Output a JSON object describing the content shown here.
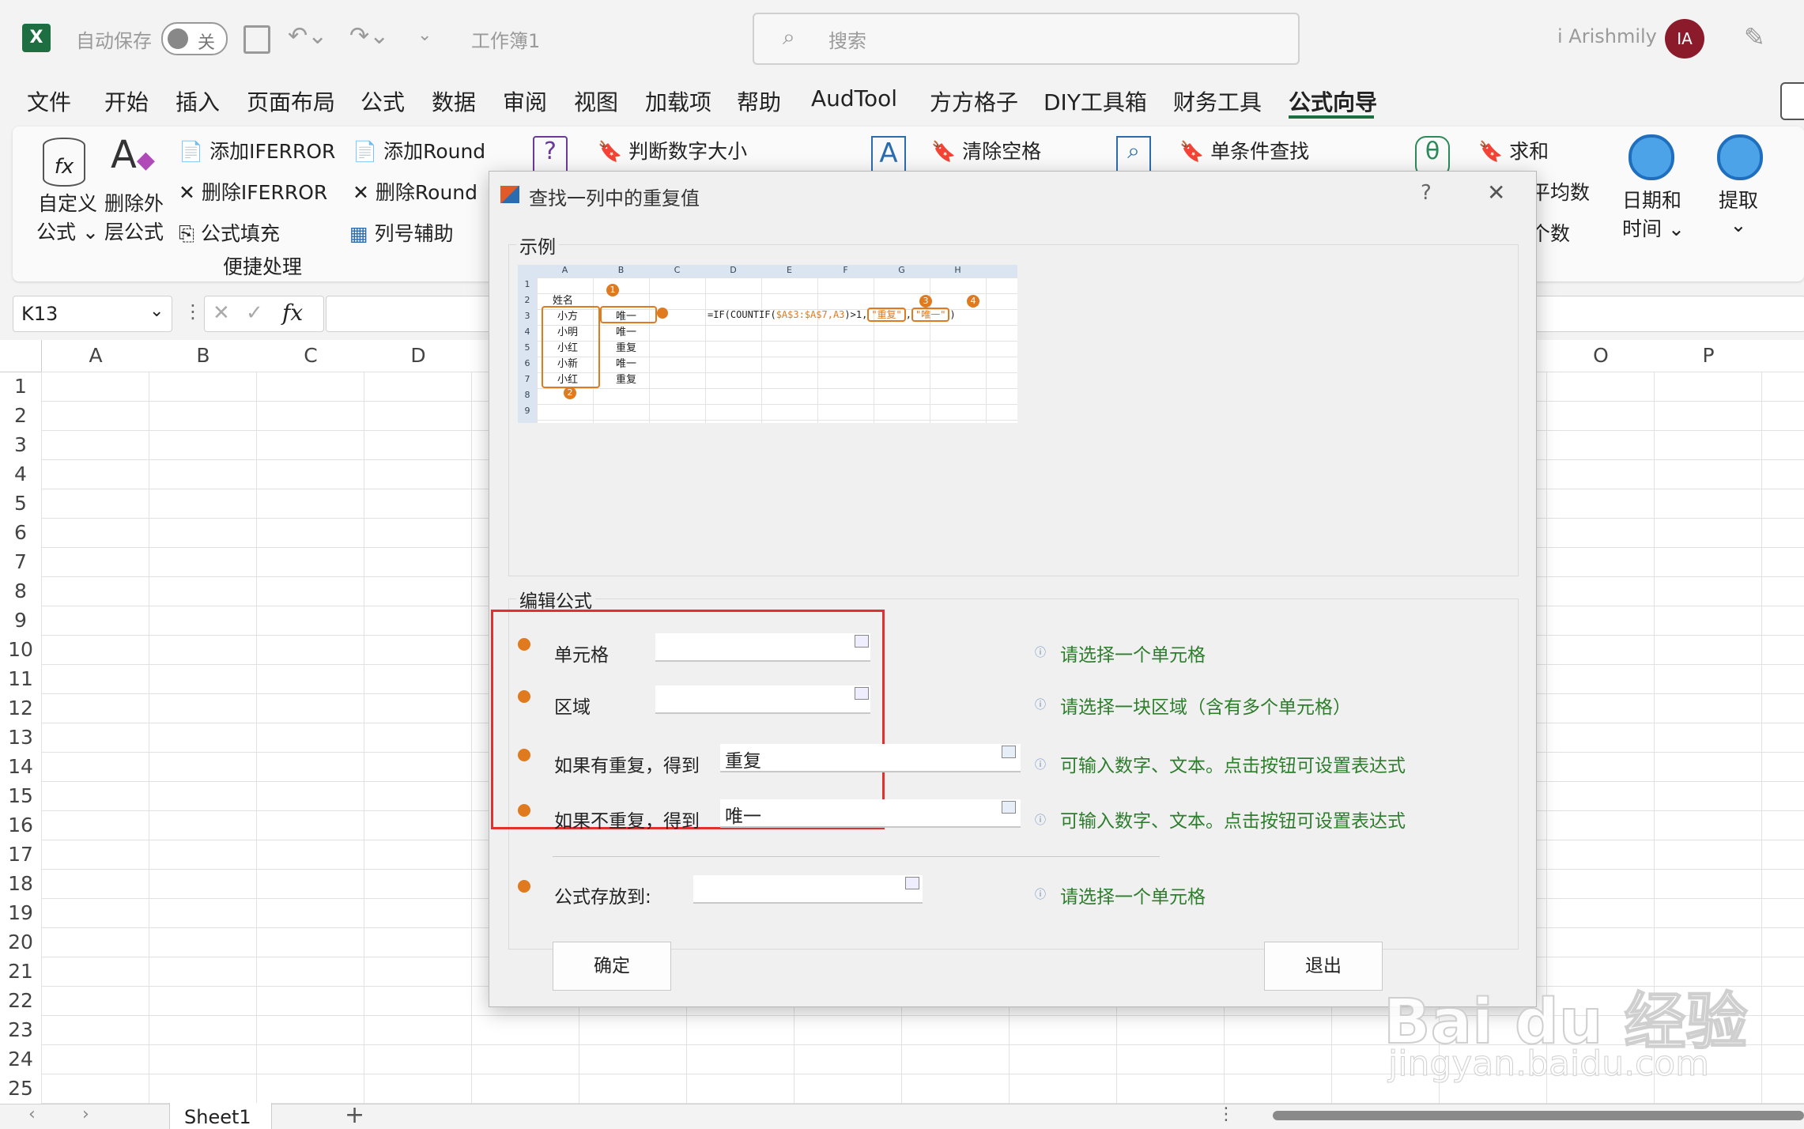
{
  "titlebar": {
    "autosave": "自动保存",
    "toggle": "关",
    "doc_title": "工作簿1",
    "search_placeholder": "搜索",
    "user": "i Arishmily",
    "avatar": "IA"
  },
  "menu": [
    "文件",
    "开始",
    "插入",
    "页面布局",
    "公式",
    "数据",
    "审阅",
    "视图",
    "加载项",
    "帮助",
    "AudTool",
    "方方格子",
    "DIY工具箱",
    "财务工具",
    "公式向导"
  ],
  "active_menu": "公式向导",
  "ribbon": {
    "custom_formula": [
      "自定义",
      "公式"
    ],
    "remove_outer": [
      "删除外",
      "层公式"
    ],
    "add_iferror": "添加IFERROR",
    "del_iferror": "删除IFERROR",
    "fill_formula": "公式填充",
    "add_round": "添加Round",
    "del_round": "删除Round",
    "col_helper": "列号辅助",
    "group_label": "便捷处理",
    "judge_num": "判断数字大小",
    "clear_space": "清除空格",
    "single_lookup": "单条件查找",
    "sum": "求和",
    "avg_partial": "平均数",
    "count_partial": "个数",
    "datetime": [
      "日期和",
      "时间"
    ],
    "extract": "提取"
  },
  "formula_bar": {
    "name_box": "K13",
    "fx": "fx"
  },
  "columns": [
    "A",
    "B",
    "C",
    "D",
    "O",
    "P"
  ],
  "rows": [
    "1",
    "2",
    "3",
    "4",
    "5",
    "6",
    "7",
    "8",
    "9",
    "10",
    "11",
    "12",
    "13",
    "14",
    "15",
    "16",
    "17",
    "18",
    "19",
    "20",
    "21",
    "22",
    "23",
    "24",
    "25"
  ],
  "sheet_tab": "Sheet1",
  "dialog": {
    "title": "查找一列中的重复值",
    "help": "?",
    "close": "✕",
    "example_group": "示例",
    "edit_group": "编辑公式",
    "example": {
      "cols": [
        "A",
        "B",
        "C",
        "D",
        "E",
        "F",
        "G",
        "H"
      ],
      "header": "姓名",
      "names": [
        "小方",
        "小明",
        "小红",
        "小新",
        "小红"
      ],
      "results": [
        "唯一",
        "唯一",
        "重复",
        "唯一",
        "重复"
      ],
      "formula_prefix": "=IF(COUNTIF(",
      "formula_range": "$A$3:$A$7,A3",
      "formula_mid": ")>1,",
      "dup": "\"重复\"",
      "uniq": "\"唯一\"",
      "close_paren": ")",
      "marks": [
        "1",
        "2",
        "3",
        "4"
      ]
    },
    "fields": [
      {
        "label": "单元格",
        "value": "",
        "hint": "请选择一个单元格"
      },
      {
        "label": "区域",
        "value": "",
        "hint": "请选择一块区域（含有多个单元格）"
      },
      {
        "label": "如果有重复，得到",
        "value": "重复",
        "hint": "可输入数字、文本。点击按钮可设置表达式"
      },
      {
        "label": "如果不重复，得到",
        "value": "唯一",
        "hint": "可输入数字、文本。点击按钮可设置表达式"
      },
      {
        "label": "公式存放到:",
        "value": "",
        "hint": "请选择一个单元格"
      }
    ],
    "ok": "确定",
    "exit": "退出"
  },
  "watermark": {
    "brand": "Bai du 经验",
    "url": "jingyan.baidu.com"
  },
  "colors": {
    "accent": "#e07a1f",
    "highlight": "#e03030",
    "hint": "#2d7d2d",
    "excel_green": "#1d6f42"
  }
}
